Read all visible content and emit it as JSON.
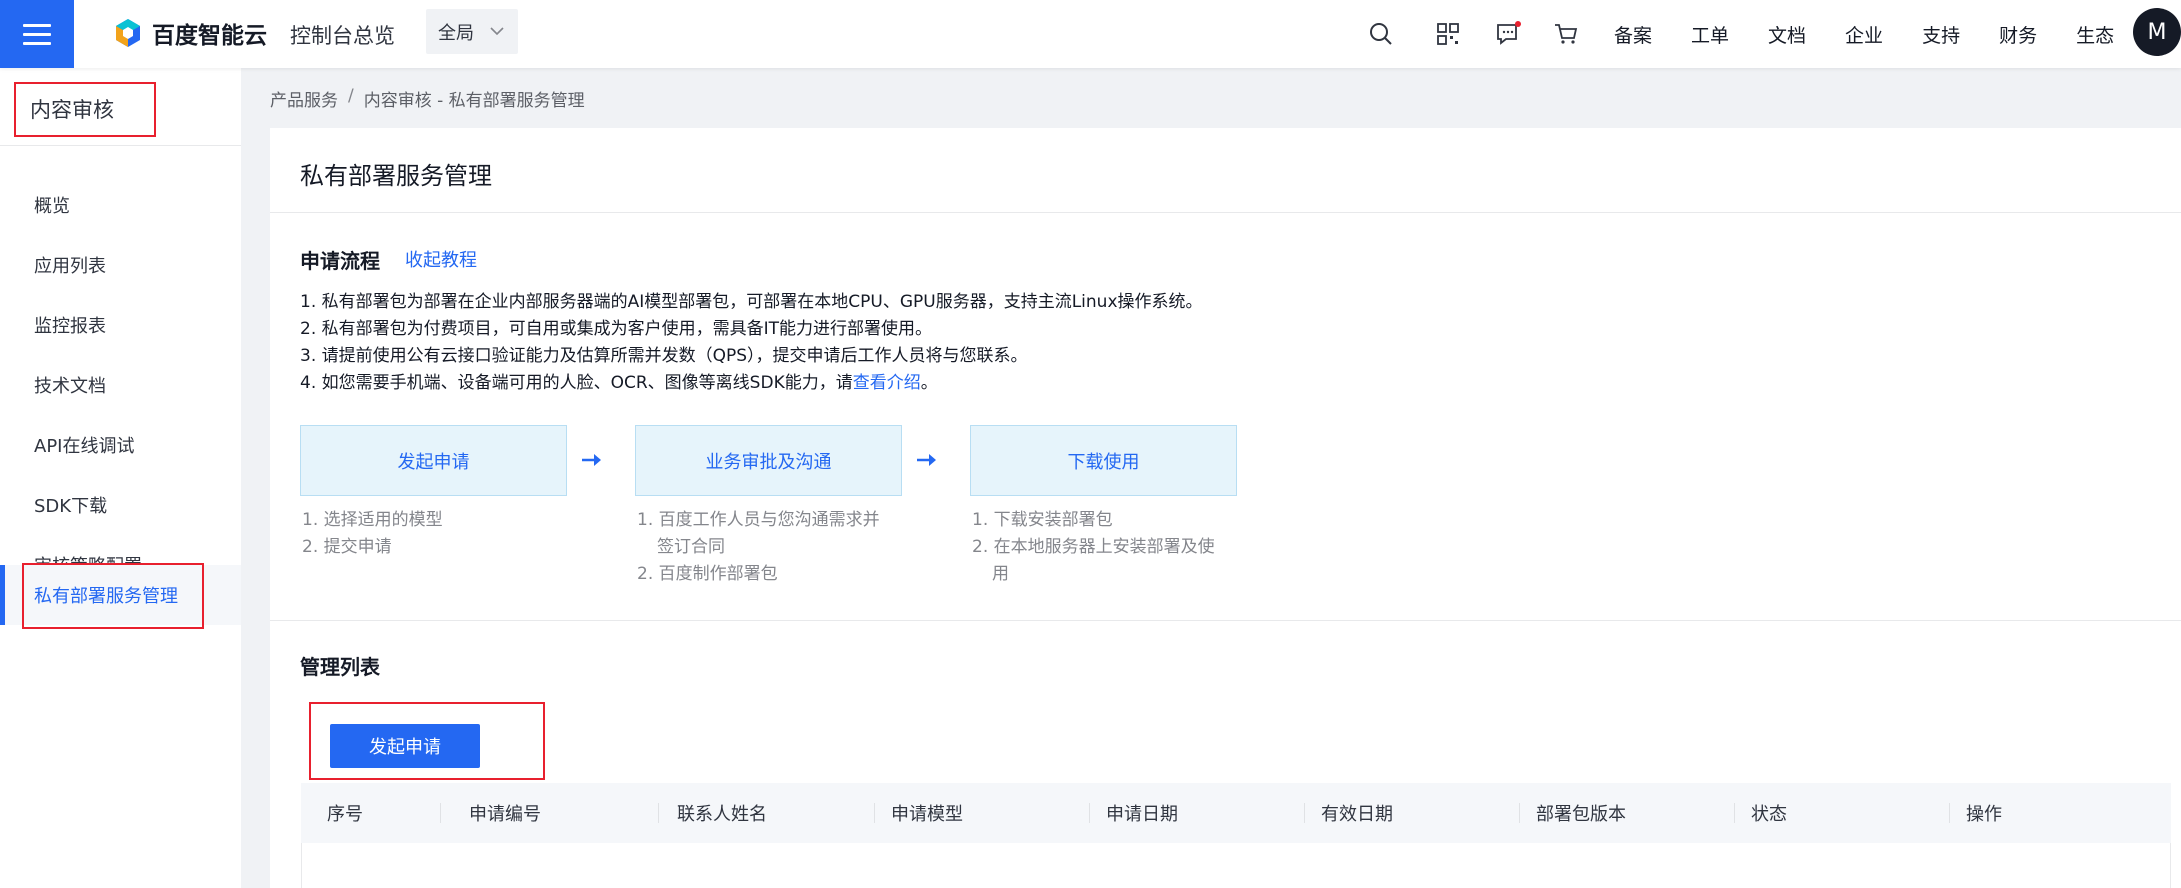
{
  "topbar": {
    "logo_text": "百度智能云",
    "console_link": "控制台总览",
    "region": "全局",
    "nav_links": [
      "备案",
      "工单",
      "文档",
      "企业",
      "支持",
      "财务",
      "生态"
    ],
    "avatar_initial": "M",
    "accent_color": "#2468f2",
    "notification_dot_color": "#e8202e"
  },
  "sidebar": {
    "title": "内容审核",
    "items": [
      {
        "label": "概览"
      },
      {
        "label": "应用列表"
      },
      {
        "label": "监控报表"
      },
      {
        "label": "技术文档"
      },
      {
        "label": "API在线调试"
      },
      {
        "label": "SDK下载"
      },
      {
        "label": "审核策略配置"
      },
      {
        "label": "私有部署服务管理",
        "active": true
      }
    ]
  },
  "breadcrumb": {
    "root": "产品服务",
    "separator": "/",
    "current": "内容审核 - 私有部署服务管理"
  },
  "main": {
    "title": "私有部署服务管理",
    "process": {
      "title": "申请流程",
      "collapse_link": "收起教程",
      "rules": [
        "1. 私有部署包为部署在企业内部服务器端的AI模型部署包，可部署在本地CPU、GPU服务器，支持主流Linux操作系统。",
        "2. 私有部署包为付费项目，可自用或集成为客户使用，需具备IT能力进行部署使用。",
        "3. 请提前使用公有云接口验证能力及估算所需并发数（QPS），提交申请后工作人员将与您联系。"
      ],
      "rule4_prefix": "4. 如您需要手机端、设备端可用的人脸、OCR、图像等离线SDK能力，请",
      "rule4_link": "查看介绍",
      "rule4_suffix": "。",
      "steps": [
        {
          "label": "发起申请",
          "notes": [
            "1. 选择适用的模型",
            "2. 提交申请"
          ]
        },
        {
          "label": "业务审批及沟通",
          "notes": [
            "1. 百度工作人员与您沟通需求并",
            "签订合同",
            "2. 百度制作部署包"
          ]
        },
        {
          "label": "下载使用",
          "notes": [
            "1. 下载安装部署包",
            "2. 在本地服务器上安装部署及使",
            "用"
          ]
        }
      ]
    },
    "list": {
      "title": "管理列表",
      "apply_button": "发起申请",
      "columns": [
        "序号",
        "申请编号",
        "联系人姓名",
        "申请模型",
        "申请日期",
        "有效日期",
        "部署包版本",
        "状态",
        "操作"
      ]
    }
  }
}
